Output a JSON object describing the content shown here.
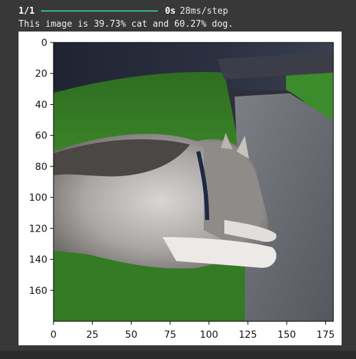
{
  "progress": {
    "step_count": "1/1",
    "fraction_complete": 1.0,
    "elapsed": "0s",
    "step_time": "28ms/step"
  },
  "result_text": "This image is 39.73% cat and 60.27% dog.",
  "plot": {
    "x_ticks": [
      "0",
      "25",
      "50",
      "75",
      "100",
      "125",
      "150",
      "175"
    ],
    "y_ticks": [
      "0",
      "20",
      "40",
      "60",
      "80",
      "100",
      "120",
      "140",
      "160"
    ],
    "xlim": [
      0,
      180
    ],
    "ylim": [
      180,
      0
    ]
  },
  "colors": {
    "background": "#383838",
    "progress_bar": "#3fb98d"
  }
}
